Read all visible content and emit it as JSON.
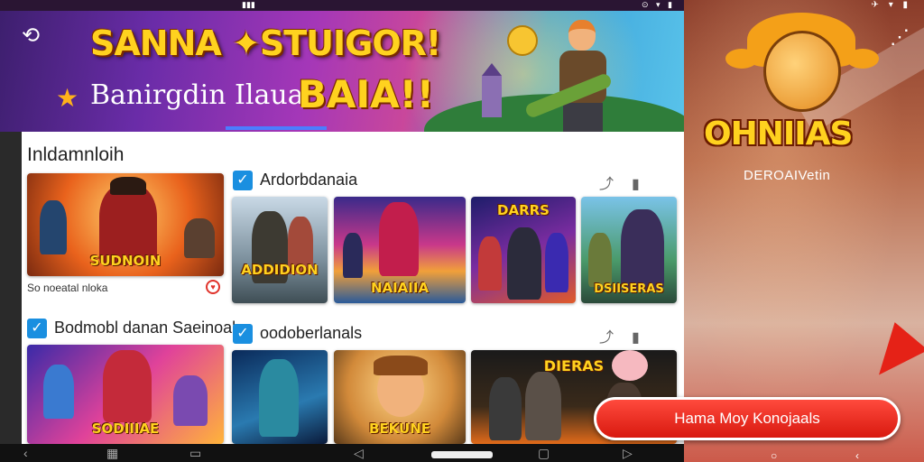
{
  "banner": {
    "title": "SANNA ✦STUIGOR!",
    "subtitle": "Banirgdin Ilaua",
    "subtitle_big": "BAIA!!"
  },
  "main": {
    "section_title": "Inldamnloih",
    "feature_card": {
      "caption": "SUDNOIN",
      "meta": "So noeatal nloka"
    },
    "section_a": {
      "label": "Ardorbdanaia",
      "cards": [
        {
          "caption": "ADDIDION"
        },
        {
          "caption": "NAIAIIA"
        },
        {
          "caption": "DARRS"
        },
        {
          "caption": "DSIISERAS"
        }
      ]
    },
    "section_b": {
      "label": "Bodmobl danan Saeinoal",
      "card_caption": "SODIIIAE"
    },
    "section_c": {
      "label": "oodoberlanals",
      "cards": [
        {
          "caption": ""
        },
        {
          "caption": "BEKUNE"
        },
        {
          "caption": "DIERAS"
        }
      ]
    }
  },
  "side": {
    "app_name": "OHNIIAS",
    "developer": "DEROAIVetin",
    "install_button": "Hama Moy Konojaals"
  },
  "colors": {
    "accent_blue": "#1a8fe0",
    "install_red": "#e52217",
    "title_yellow": "#ffd21f"
  }
}
